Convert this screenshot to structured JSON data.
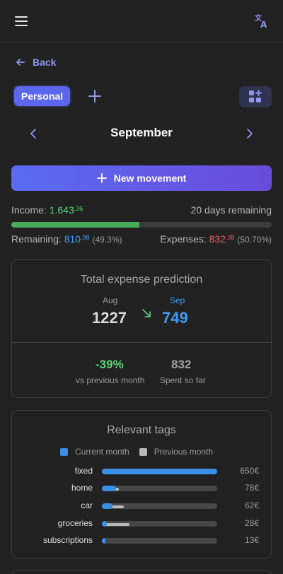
{
  "header": {
    "menu_icon": "hamburger-icon",
    "translate_icon": "translate-icon"
  },
  "nav": {
    "back_label": "Back"
  },
  "account": {
    "active": "Personal",
    "add_icon": "plus-icon",
    "grid_icon": "grid-add-icon"
  },
  "month": {
    "label": "September"
  },
  "actions": {
    "new_movement": "New movement"
  },
  "summary": {
    "income_label": "Income:",
    "income_main": "1.643",
    "income_cents": ".36",
    "days_remaining": "20 days remaining",
    "progress_fraction": 0.493,
    "remaining_label": "Remaining:",
    "remaining_main": "810",
    "remaining_cents": ".98",
    "remaining_pct": "(49.3%)",
    "expenses_label": "Expenses:",
    "expenses_main": "832",
    "expenses_cents": ".38",
    "expenses_pct": "(50.70%)",
    "colors": {
      "income": "#5ed17a",
      "remaining": "#3f9bf0",
      "expenses": "#ee5c67"
    }
  },
  "prediction": {
    "title": "Total expense prediction",
    "prev_month": "Aug",
    "prev_value": "1227",
    "cur_month": "Sep",
    "cur_value": "749",
    "change_value": "-39%",
    "change_label": "vs previous month",
    "spent_value": "832",
    "spent_label": "Spent so far"
  },
  "tags": {
    "title": "Relevant tags",
    "legend_current": "Current month",
    "legend_previous": "Previous month",
    "colors": {
      "current": "#3a8fe3",
      "previous": "#b8b8b8"
    },
    "items": [
      {
        "name": "fixed",
        "amount": "650€",
        "current": 1.0,
        "previous": 0.97
      },
      {
        "name": "home",
        "amount": "78€",
        "current": 0.12,
        "previous": 0.15
      },
      {
        "name": "car",
        "amount": "62€",
        "current": 0.09,
        "previous": 0.19
      },
      {
        "name": "groceries",
        "amount": "28€",
        "current": 0.04,
        "previous": 0.24
      },
      {
        "name": "subscriptions",
        "amount": "13€",
        "current": 0.02,
        "previous": 0.02
      }
    ]
  }
}
